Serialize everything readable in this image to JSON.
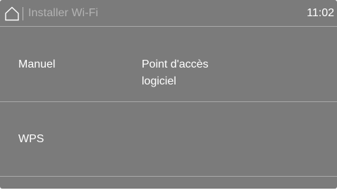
{
  "status_bar": {
    "title": "Installer Wi-Fi",
    "time": "11:02",
    "home_icon": "home-icon"
  },
  "options": {
    "manual": "Manuel",
    "soft_ap_line1": "Point d'accès",
    "soft_ap_line2": "logiciel",
    "wps": "WPS"
  },
  "colors": {
    "background": "#7b7b7b",
    "divider": "#a9a9a9",
    "title_text": "#b3b3b3",
    "text": "#ffffff"
  }
}
